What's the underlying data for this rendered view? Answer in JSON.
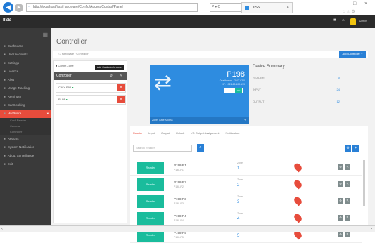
{
  "browser": {
    "url": "http://localhost/iiss/Hardware/Config/AccessControl/Panel",
    "search_text": "P ▾ C",
    "tab_label": "IISS",
    "win_min": "–",
    "win_max": "□",
    "win_close": "×"
  },
  "app": {
    "brand": "IISS",
    "user": "Admin"
  },
  "sidebar": {
    "items": [
      {
        "label": "Dashboard",
        "active": false
      },
      {
        "label": "User Accounts",
        "active": false
      },
      {
        "label": "Settings",
        "active": false
      },
      {
        "label": "Licence",
        "active": false
      },
      {
        "label": "Alert",
        "active": false
      },
      {
        "label": "Usage Tracking",
        "active": false
      },
      {
        "label": "Reminder",
        "active": false
      },
      {
        "label": "Car Booking",
        "active": false
      },
      {
        "label": "Hardware",
        "active": true
      }
    ],
    "subitems": [
      "Card Reader",
      "Camera",
      "Controller"
    ],
    "items_after": [
      "Reports",
      "System Notification",
      "About Surveillance",
      "Exit"
    ]
  },
  "page": {
    "title": "Controller",
    "breadcrumb": "⌂ / Hardware / Controller",
    "add_button": "Add Controller +"
  },
  "tree": {
    "header": "Controller",
    "zone_label": "Comm Zone",
    "tooltip": "Add Controller to zone",
    "items": [
      {
        "label": "C98Y-P98",
        "status": "●"
      },
      {
        "label": "P198",
        "status": "●"
      }
    ]
  },
  "hero": {
    "name": "P198",
    "line1": "Ocaribbean - 2.42 V2.0",
    "line2": "IP: 192.168.100.199",
    "toggle": "ON",
    "footer": "Zone: Gate Access"
  },
  "summary": {
    "title": "Device Summary",
    "rows": [
      {
        "label": "READER",
        "value": "0"
      },
      {
        "label": "INPUT",
        "value": "24"
      },
      {
        "label": "OUTPUT",
        "value": "12"
      }
    ]
  },
  "tabs": [
    "Reader",
    "Input",
    "Output",
    "Unlock",
    "I/O Output Assignment",
    "Notification"
  ],
  "device_search": {
    "placeholder": "Search Reader"
  },
  "devices": [
    {
      "chip": "Reader",
      "name": "P198-R1",
      "sub": "P198-R1",
      "zone_label": "Zone",
      "zone": "1"
    },
    {
      "chip": "Reader",
      "name": "P198-R2",
      "sub": "P198-R2",
      "zone_label": "Zone",
      "zone": "2"
    },
    {
      "chip": "Reader",
      "name": "P198-R3",
      "sub": "P198-R3",
      "zone_label": "Zone",
      "zone": "3"
    },
    {
      "chip": "Reader",
      "name": "P198-R4",
      "sub": "P198-R4",
      "zone_label": "Zone",
      "zone": "4"
    },
    {
      "chip": "Reader",
      "name": "P198-R5",
      "sub": "P198-R5",
      "zone_label": "Zone",
      "zone": "5"
    }
  ],
  "colors": {
    "accent": "#2e8ce0",
    "danger": "#e74c3c",
    "sidebar": "#3a3a3a",
    "topbar": "#2b2b2b",
    "chip": "#1abc9c"
  }
}
